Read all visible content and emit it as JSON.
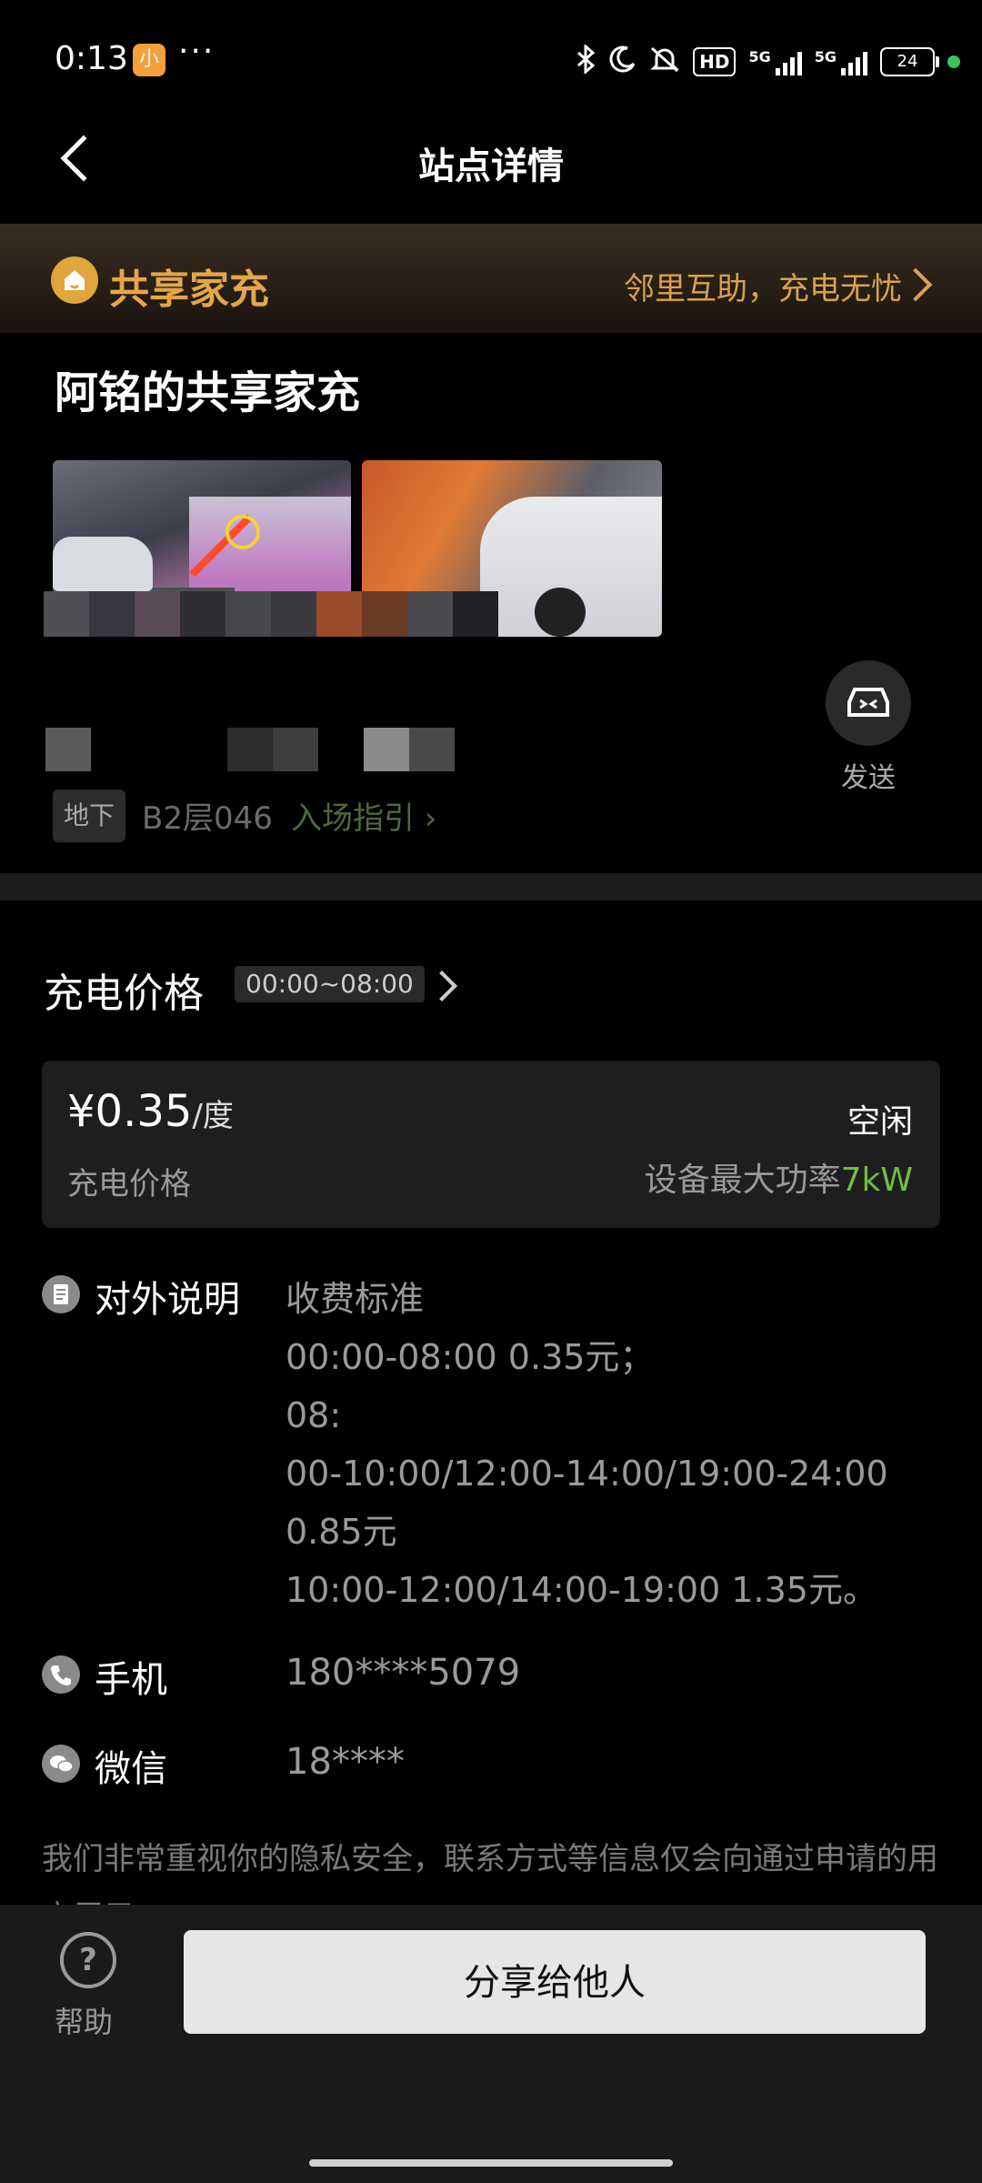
{
  "status_bar": {
    "time": "0:13",
    "app_badge": "小",
    "more": "···",
    "hd_label": "HD",
    "network_1": "5G",
    "network_2": "5G",
    "battery": "24"
  },
  "header": {
    "title": "站点详情"
  },
  "banner": {
    "title": "共享家充",
    "slogan": "邻里互助，充电无忧"
  },
  "station": {
    "name": "阿铭的共享家充",
    "location_tag": "地下",
    "location_text": "B2层046",
    "guide_link": "入场指引"
  },
  "send": {
    "label": "发送"
  },
  "price_section": {
    "title": "充电价格",
    "time_range": "00:00~08:00",
    "price": "¥0.35",
    "unit": "/度",
    "price_label": "充电价格",
    "status": "空闲",
    "power_label": "设备最大功率",
    "power_value": "7kW"
  },
  "info": {
    "desc_label": "对外说明",
    "desc_text": "收费标准\n00:00-08:00 0.35元；\n08:\n00-10:00/12:00-14:00/19:00-24:00\n0.85元\n10:00-12:00/14:00-19:00 1.35元。",
    "phone_label": "手机",
    "phone_value": "180****5079",
    "wechat_label": "微信",
    "wechat_value": "18****"
  },
  "privacy_note": "我们非常重视你的隐私安全，联系方式等信息仅会向通过申请的用户展示",
  "bottom_bar": {
    "help_label": "帮助",
    "share_label": "分享给他人"
  },
  "colors": {
    "accent_gold": "#e3a74a",
    "power_green": "#6fbf3c",
    "background": "#000000",
    "card": "#1e1e20"
  }
}
